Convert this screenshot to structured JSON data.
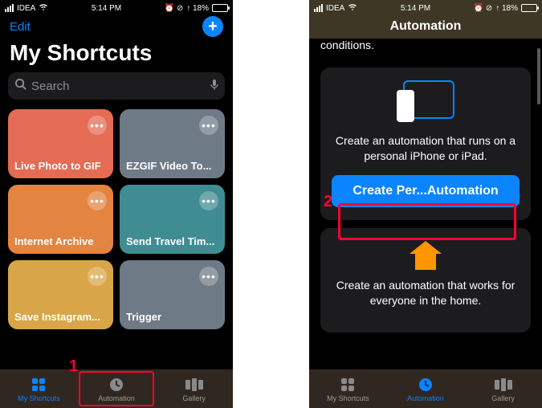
{
  "status": {
    "carrier": "IDEA",
    "time": "5:14 PM",
    "battery_text": "↑ 18%",
    "icons": "⏰ ⊘"
  },
  "left": {
    "edit": "Edit",
    "title": "My Shortcuts",
    "search_placeholder": "Search",
    "tiles": [
      {
        "label": "Live Photo to GIF",
        "color": "#e46b54"
      },
      {
        "label": "EZGIF Video To...",
        "color": "#6f7a87"
      },
      {
        "label": "Internet Archive",
        "color": "#e38441"
      },
      {
        "label": "Send Travel Tim...",
        "color": "#3f8d92"
      },
      {
        "label": "Save Instagram...",
        "color": "#d8a648"
      },
      {
        "label": "Trigger",
        "color": "#6f7a87"
      }
    ],
    "tabs": [
      {
        "label": "My Shortcuts"
      },
      {
        "label": "Automation"
      },
      {
        "label": "Gallery"
      }
    ],
    "annotation": "1"
  },
  "right": {
    "title": "Automation",
    "desc_line": "conditions.",
    "card1": {
      "desc": "Create an automation that runs on a personal iPhone or iPad.",
      "button": "Create Per...Automation"
    },
    "card2": {
      "desc": "Create an automation that works for everyone in the home."
    },
    "tabs": [
      {
        "label": "My Shortcuts"
      },
      {
        "label": "Automation"
      },
      {
        "label": "Gallery"
      }
    ],
    "annotation": "2"
  }
}
